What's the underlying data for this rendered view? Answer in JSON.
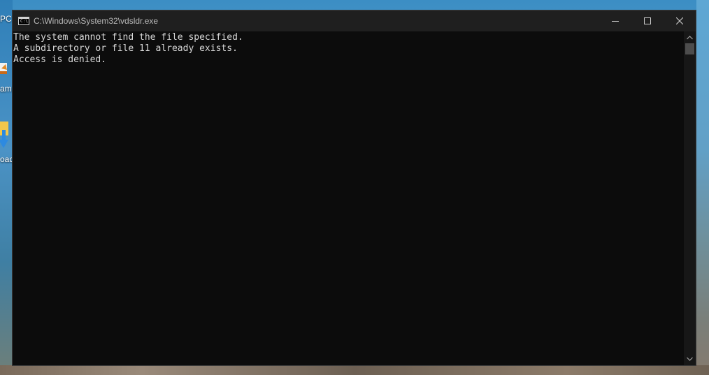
{
  "desktop": {
    "icons": [
      {
        "label": "PC",
        "icon": "computer-icon"
      },
      {
        "label": "ams",
        "icon": "app-shortcut-icon"
      },
      {
        "label": "oad",
        "icon": "download-folder-icon"
      }
    ]
  },
  "window": {
    "title": "C:\\Windows\\System32\\vdsldr.exe",
    "app_icon": "console-icon",
    "app_icon_glyph": "C:\\.",
    "controls": {
      "minimize": "minimize-icon",
      "maximize": "maximize-icon",
      "close": "close-icon"
    }
  },
  "console": {
    "lines": [
      "The system cannot find the file specified.",
      "A subdirectory or file 11 already exists.",
      "Access is denied."
    ]
  },
  "colors": {
    "titlebar": "#1f1f1f",
    "console_bg": "#0c0c0c",
    "console_text": "#d8d8d8",
    "title_text": "#b9b9b9"
  }
}
